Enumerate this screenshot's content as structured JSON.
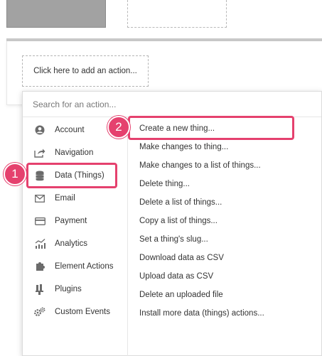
{
  "editor": {
    "add_action_label": "Click here to add an action..."
  },
  "search": {
    "placeholder": "Search for an action..."
  },
  "categories": [
    {
      "label": "Account",
      "icon": "account-icon"
    },
    {
      "label": "Navigation",
      "icon": "navigation-icon"
    },
    {
      "label": "Data (Things)",
      "icon": "database-icon"
    },
    {
      "label": "Email",
      "icon": "email-icon"
    },
    {
      "label": "Payment",
      "icon": "payment-icon"
    },
    {
      "label": "Analytics",
      "icon": "analytics-icon"
    },
    {
      "label": "Element Actions",
      "icon": "element-actions-icon"
    },
    {
      "label": "Plugins",
      "icon": "plugins-icon"
    },
    {
      "label": "Custom Events",
      "icon": "custom-events-icon"
    }
  ],
  "actions": [
    "Create a new thing...",
    "Make changes to thing...",
    "Make changes to a list of things...",
    "Delete thing...",
    "Delete a list of things...",
    "Copy a list of things...",
    "Set a thing's slug...",
    "Download data as CSV",
    "Upload data as CSV",
    "Delete an uploaded file",
    "Install more data (things) actions..."
  ],
  "annotations": {
    "badge_1": "1",
    "badge_2": "2",
    "highlight_color": "#e5416e"
  }
}
